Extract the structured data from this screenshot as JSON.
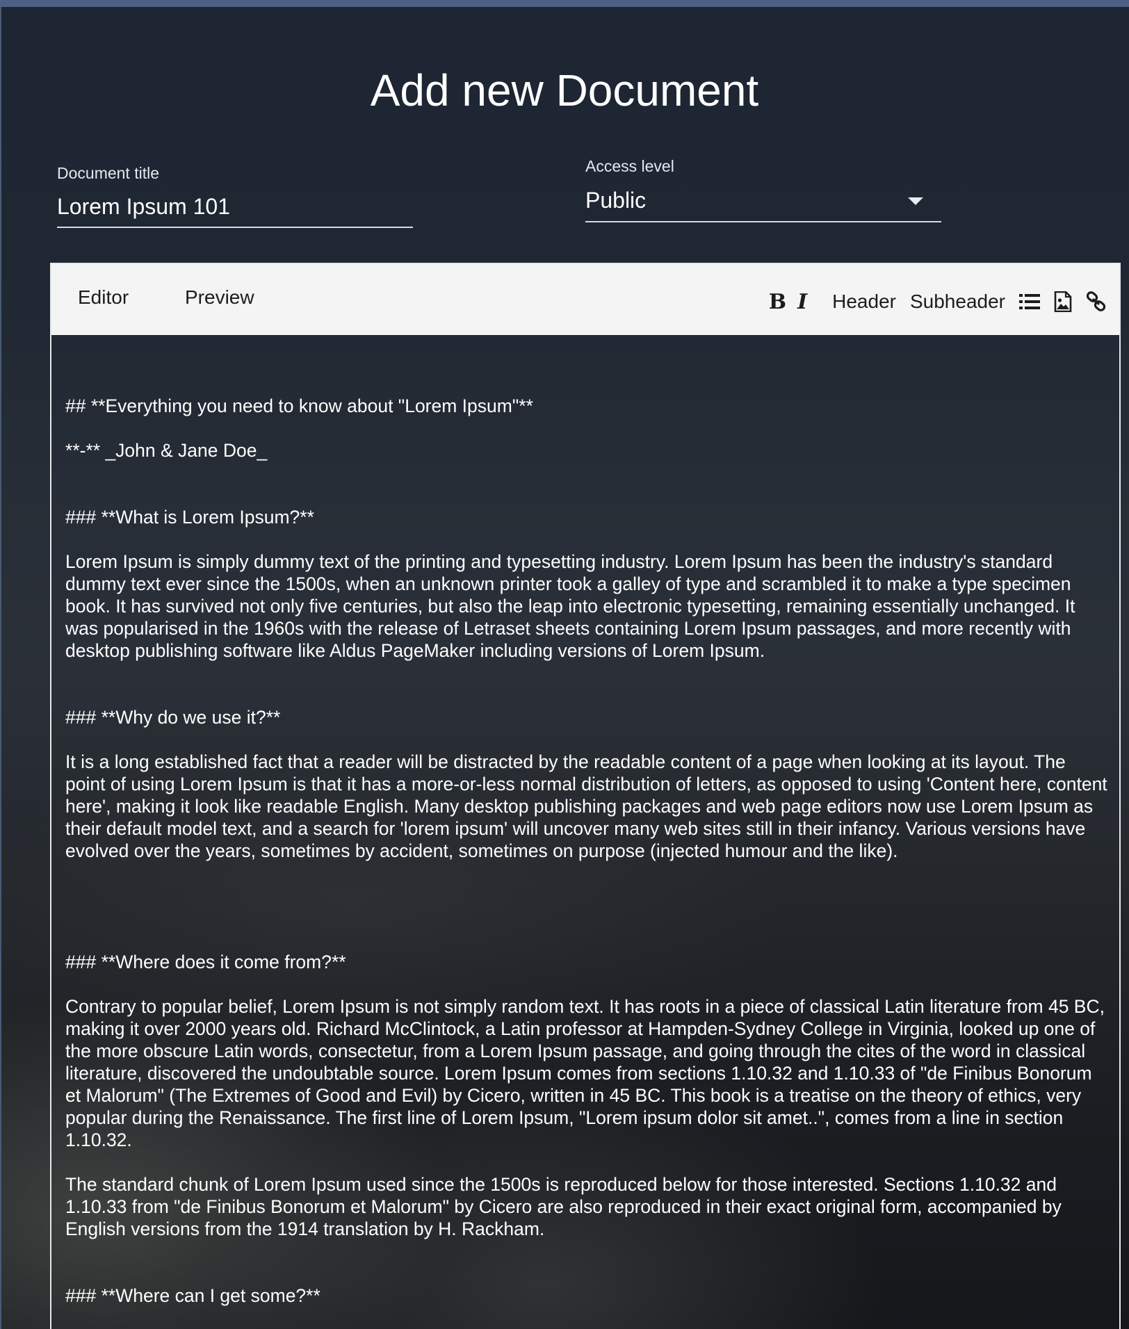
{
  "page": {
    "title": "Add new Document"
  },
  "form": {
    "document_title": {
      "label": "Document title",
      "value": "Lorem Ipsum 101"
    },
    "access_level": {
      "label": "Access level",
      "selected": "Public"
    }
  },
  "editor": {
    "tabs": {
      "editor": "Editor",
      "preview": "Preview"
    },
    "toolbar": {
      "bold": "B",
      "italic": "I",
      "header": "Header",
      "subheader": "Subheader",
      "list_icon": "list-icon",
      "image_icon": "image-icon",
      "link_icon": "link-icon"
    },
    "content": {
      "h2": "## **Everything you need to know about \"Lorem Ipsum\"**",
      "byline": "**-** _John & Jane Doe_",
      "h3_what": "### **What is Lorem Ipsum?**",
      "p_what": "Lorem Ipsum is simply dummy text of the printing and typesetting industry. Lorem Ipsum has been the industry's standard dummy text ever since the 1500s, when an unknown printer took a galley of type and scrambled it to make a type specimen book. It has survived not only five centuries, but also the leap into electronic typesetting, remaining essentially unchanged. It was popularised in the 1960s with the release of Letraset sheets containing Lorem Ipsum passages, and more recently with desktop publishing software like Aldus PageMaker including versions of Lorem Ipsum.",
      "h3_why": "### **Why do we use it?**",
      "p_why": "It is a long established fact that a reader will be distracted by the readable content of a page when looking at its layout. The point of using Lorem Ipsum is that it has a more-or-less normal distribution of letters, as opposed to using 'Content here, content here', making it look like readable English. Many desktop publishing packages and web page editors now use Lorem Ipsum as their default model text, and a search for 'lorem ipsum' will uncover many web sites still in their infancy. Various versions have evolved over the years, sometimes by accident, sometimes on purpose (injected humour and the like).",
      "h3_where": "### **Where does it come from?**",
      "p_where_1": "Contrary to popular belief, Lorem Ipsum is not simply random text. It has roots in a piece of classical Latin literature from 45 BC, making it over 2000 years old. Richard McClintock, a Latin professor at Hampden-Sydney College in Virginia, looked up one of the more obscure Latin words, consectetur, from a Lorem Ipsum passage, and going through the cites of the word in classical literature, discovered the undoubtable source. Lorem Ipsum comes from sections 1.10.32 and 1.10.33 of \"de Finibus Bonorum et Malorum\" (The Extremes of Good and Evil) by Cicero, written in 45 BC. This book is a treatise on the theory of ethics, very popular during the Renaissance. The first line of Lorem Ipsum, \"Lorem ipsum dolor sit amet..\", comes from a line in section 1.10.32.",
      "p_where_2": "The standard chunk of Lorem Ipsum used since the 1500s is reproduced below for those interested. Sections 1.10.32 and 1.10.33 from \"de Finibus Bonorum et Malorum\" by Cicero are also reproduced in their exact original form, accompanied by English versions from the 1914 translation by H. Rackham.",
      "h3_get": "### **Where can I get some?**"
    }
  }
}
